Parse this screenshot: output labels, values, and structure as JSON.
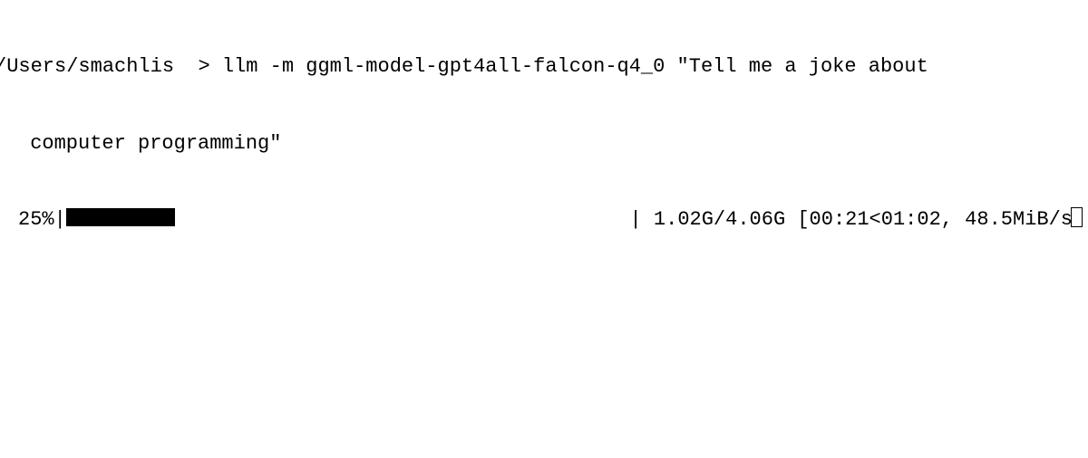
{
  "terminal": {
    "prompt_path": "/Users/smachlis",
    "prompt_symbol": ">",
    "command": "llm -m ggml-model-gpt4all-falcon-q4_0 \"Tell me a joke about",
    "command_wrap": " computer programming\"",
    "progress": {
      "percent": "25%",
      "bar_left": "|",
      "bar_fill_blocks": 9,
      "bar_right": "|",
      "done": "1.02G",
      "total": "4.06G",
      "elapsed": "00:21",
      "remaining": "01:02",
      "speed": "48.5MiB/s",
      "stats_text": " 1.02G/4.06G [00:21<01:02, 48.5MiB/s"
    }
  }
}
